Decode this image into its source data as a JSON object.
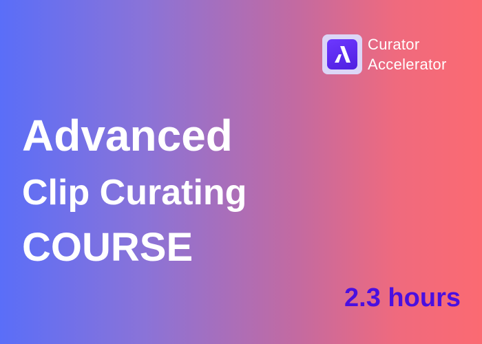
{
  "brand": {
    "logo_icon": "lambda-a-icon",
    "line1": "Curator",
    "line2": "Accelerator"
  },
  "headline": {
    "line1": "Advanced",
    "line2": "Clip Curating",
    "line3": "COURSE"
  },
  "duration": "2.3 hours",
  "colors": {
    "gradient_start": "#5a6ef8",
    "gradient_end": "#fb6a72",
    "duration_text": "#4a0fe0",
    "logo_bg": "#6d38ff"
  }
}
